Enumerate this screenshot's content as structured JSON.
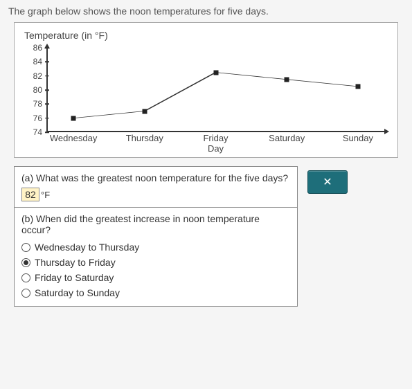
{
  "prompt": "The graph below shows the noon temperatures for five days.",
  "chart_data": {
    "type": "line",
    "title": "Temperature (in °F)",
    "xlabel": "Day",
    "ylabel": "",
    "ylim": [
      74,
      86
    ],
    "y_ticks": [
      74,
      76,
      78,
      80,
      82,
      84,
      86
    ],
    "categories": [
      "Wednesday",
      "Thursday",
      "Friday",
      "Saturday",
      "Sunday"
    ],
    "values": [
      76,
      77,
      82.5,
      81.5,
      80.5
    ]
  },
  "qa": {
    "a": {
      "question": "(a) What was the greatest noon temperature for the five days?",
      "answer_value": "82",
      "unit": "°F"
    },
    "b": {
      "question": "(b) When did the greatest increase in noon temperature occur?",
      "options": [
        "Wednesday to Thursday",
        "Thursday to Friday",
        "Friday to Saturday",
        "Saturday to Sunday"
      ],
      "selected_index": 1
    }
  },
  "buttons": {
    "close_label": "✕"
  }
}
